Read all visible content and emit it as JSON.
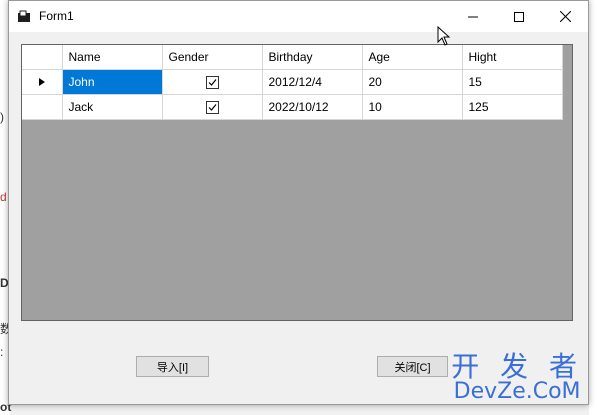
{
  "window": {
    "title": "Form1"
  },
  "grid": {
    "columns": [
      "Name",
      "Gender",
      "Birthday",
      "Age",
      "Hight"
    ],
    "rows": [
      {
        "name": "John",
        "gender_checked": true,
        "birthday": "2012/12/4",
        "age": "20",
        "hight": "15",
        "current": true
      },
      {
        "name": "Jack",
        "gender_checked": true,
        "birthday": "2022/10/12",
        "age": "10",
        "hight": "125",
        "current": false
      }
    ],
    "colors": {
      "selection": "#0078d7",
      "empty_area": "#a0a0a0"
    }
  },
  "buttons": {
    "import": "导入[I]",
    "close": "关闭[C]"
  },
  "background_fragments": [
    ")",
    "d",
    "D",
    "数",
    ":",
    "ot"
  ],
  "watermark": {
    "line1": "开 发 者",
    "line2": "DevZe.CoM"
  }
}
